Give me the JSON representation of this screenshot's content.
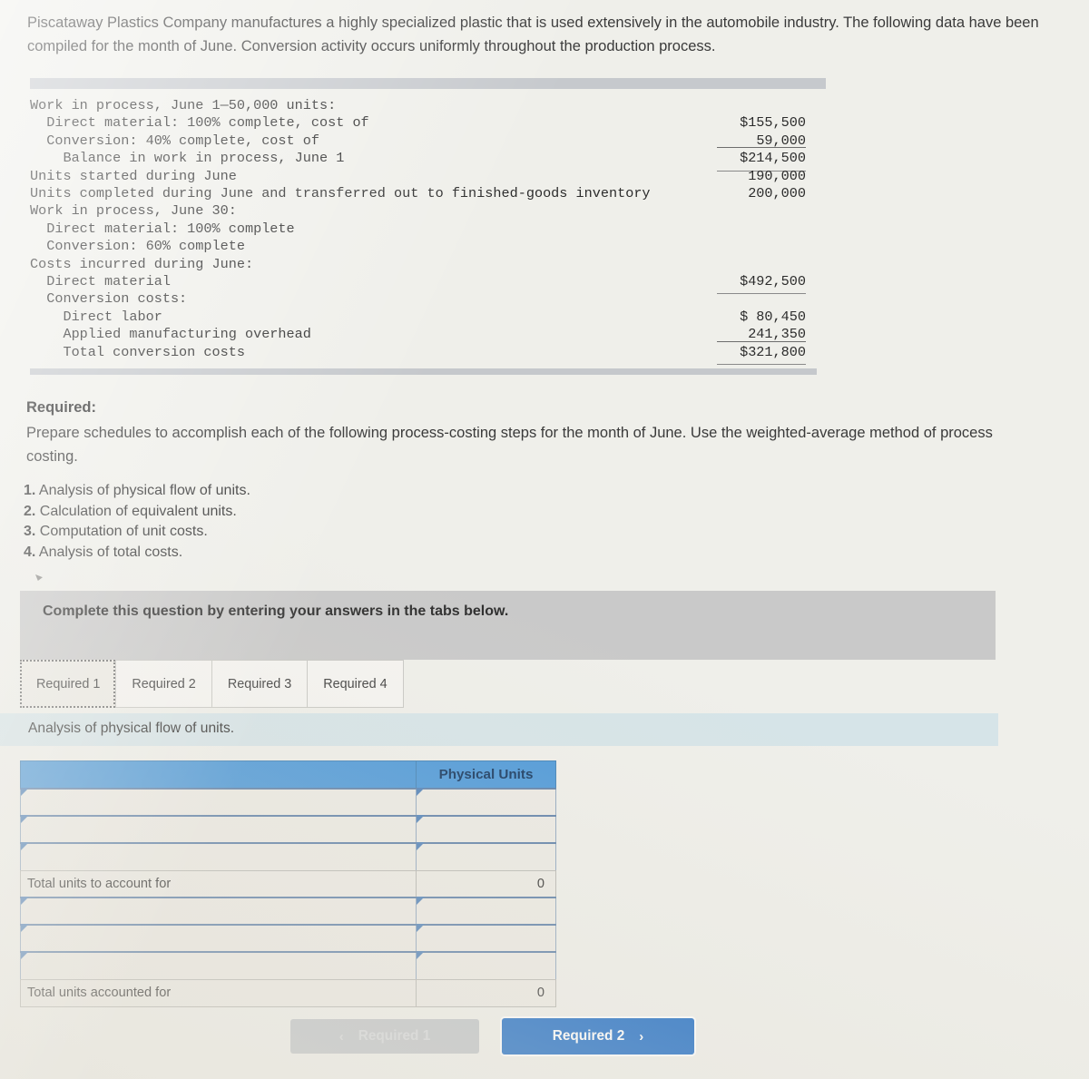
{
  "intro": {
    "paragraph": "Piscataway Plastics Company manufactures a highly specialized plastic that is used extensively in the automobile industry. The following data have been compiled for the month of June. Conversion activity occurs uniformly throughout the production process."
  },
  "data_block": {
    "rows": [
      {
        "label": "Work in process, June 1—50,000 units:",
        "value": ""
      },
      {
        "label": "  Direct material: 100% complete, cost of",
        "value": "$155,500"
      },
      {
        "label": "  Conversion: 40% complete, cost of",
        "value": "59,000"
      },
      {
        "label": "    Balance in work in process, June 1",
        "value": "$214,500"
      },
      {
        "label": "Units started during June",
        "value": "190,000"
      },
      {
        "label": "Units completed during June and transferred out to finished-goods inventory",
        "value": "200,000"
      },
      {
        "label": "Work in process, June 30:",
        "value": ""
      },
      {
        "label": "  Direct material: 100% complete",
        "value": ""
      },
      {
        "label": "  Conversion: 60% complete",
        "value": ""
      },
      {
        "label": "Costs incurred during June:",
        "value": ""
      },
      {
        "label": "  Direct material",
        "value": "$492,500"
      },
      {
        "label": "  Conversion costs:",
        "value": ""
      },
      {
        "label": "    Direct labor",
        "value": "$ 80,450"
      },
      {
        "label": "    Applied manufacturing overhead",
        "value": "241,350"
      },
      {
        "label": "    Total conversion costs",
        "value": "$321,800"
      }
    ]
  },
  "required": {
    "heading": "Required:",
    "body": "Prepare schedules to accomplish each of the following process-costing steps for the month of June. Use the weighted-average method of process costing.",
    "steps": [
      {
        "num": "1.",
        "text": "Analysis of physical flow of units."
      },
      {
        "num": "2.",
        "text": "Calculation of equivalent units."
      },
      {
        "num": "3.",
        "text": "Computation of unit costs."
      },
      {
        "num": "4.",
        "text": "Analysis of total costs."
      }
    ]
  },
  "banner": {
    "text": "Complete this question by entering your answers in the tabs below."
  },
  "tabs": [
    {
      "label": "Required 1",
      "active": true
    },
    {
      "label": "Required 2",
      "active": false
    },
    {
      "label": "Required 3",
      "active": false
    },
    {
      "label": "Required 4",
      "active": false
    }
  ],
  "section": {
    "title": "Analysis of physical flow of units."
  },
  "answer_table": {
    "headers": {
      "col1": "",
      "col2": "Physical Units"
    },
    "rows": [
      {
        "type": "input",
        "label": "",
        "value": ""
      },
      {
        "type": "input",
        "label": "",
        "value": ""
      },
      {
        "type": "input",
        "label": "",
        "value": ""
      },
      {
        "type": "total",
        "label": "Total units to account for",
        "value": "0"
      },
      {
        "type": "input",
        "label": "",
        "value": ""
      },
      {
        "type": "input",
        "label": "",
        "value": ""
      },
      {
        "type": "input",
        "label": "",
        "value": ""
      },
      {
        "type": "total",
        "label": "Total units accounted for",
        "value": "0"
      }
    ]
  },
  "footer": {
    "prev_label": "Required 1",
    "prev_chevron": "‹",
    "next_label": "Required 2",
    "next_chevron": "›"
  },
  "colors": {
    "page_background": "#efefea",
    "table_header_blue": "#4a97d8",
    "section_band_blue": "#d6e4e8",
    "banner_gray": "#c9c9c9",
    "primary_button_blue": "#1668c4",
    "disabled_button_gray": "#bfc3c7"
  }
}
